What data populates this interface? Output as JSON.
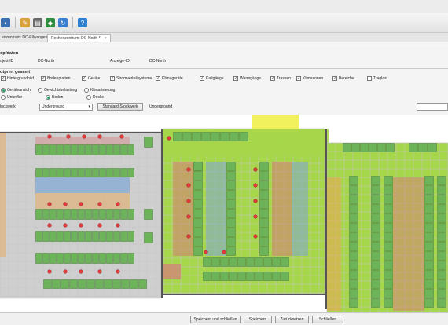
{
  "tabs": [
    {
      "label": "enzentrum: DC-Ellwangen",
      "close": "×"
    },
    {
      "label": "Rechenzentrum: DC-North *",
      "close": "×"
    }
  ],
  "form": {
    "section_stammdaten": "opfdaten",
    "objekt_label": "ojekt-ID",
    "objekt_value": "DC-North",
    "anzeige_label": "Anzeige-ID",
    "anzeige_value": "DC-North",
    "section_footprint": "otprint gesamt"
  },
  "layers": [
    {
      "label": "Hintergrundbild",
      "checked": true
    },
    {
      "label": "Bodenplatten",
      "checked": true
    },
    {
      "label": "Geräte",
      "checked": true
    },
    {
      "label": "Stromverteilsysteme",
      "checked": true
    },
    {
      "label": "Klimageräte",
      "checked": true
    },
    {
      "label": "Kaltgänge",
      "checked": true
    },
    {
      "label": "Warmgänge",
      "checked": true
    },
    {
      "label": "Trassen",
      "checked": true
    },
    {
      "label": "Klimazonen",
      "checked": true
    },
    {
      "label": "Bereiche",
      "checked": true
    },
    {
      "label": "Traglast",
      "checked": false
    }
  ],
  "view_options": {
    "row1": [
      {
        "label": "Geräteansicht",
        "selected": true
      },
      {
        "label": "Gewichtsbelastung",
        "selected": false
      },
      {
        "label": "Klimatisierung",
        "selected": false
      }
    ],
    "row2": [
      {
        "label": "Unterflur",
        "selected": false
      },
      {
        "label": "Boden",
        "selected": true
      },
      {
        "label": "Decke",
        "selected": false
      }
    ]
  },
  "stockwerk": {
    "label": "tockwerk",
    "selected": "Underground",
    "standard_button": "Standard-Stockwerk",
    "current": "Underground"
  },
  "buttons": {
    "save_close": "Speichern und schließen",
    "save": "Speichern",
    "reset": "Zurücksetzen",
    "close": "Schließen"
  },
  "colors": {
    "rack_green": "#6db35a",
    "rack_gray": "#d9d9d9",
    "cold_blue": "#7fa6d6",
    "warm_red": "#d77a7a",
    "orange": "#e6a857",
    "yellow": "#eef04a",
    "lime": "#a6d64a"
  }
}
